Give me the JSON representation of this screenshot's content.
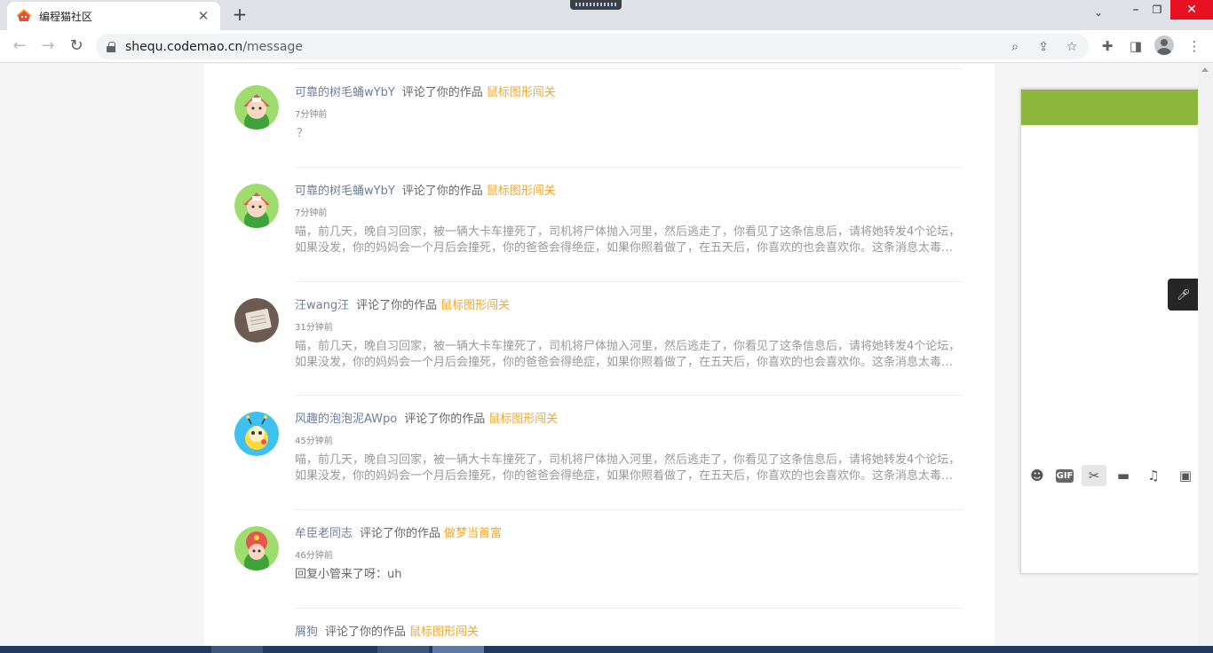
{
  "browser": {
    "tab_title": "编程猫社区",
    "url_host": "shequ.codemao.cn",
    "url_path": "/message",
    "icons": [
      "close-icon",
      "plus-icon",
      "back-icon",
      "forward-icon",
      "reload-icon",
      "lock-icon",
      "zoom-icon",
      "share-icon",
      "star-icon",
      "puzzle-icon",
      "sidepanel-icon",
      "profile-icon",
      "menu-icon",
      "minimize-icon",
      "maximize-icon"
    ]
  },
  "messages": [
    {
      "user": "可靠的树毛蛹wYbY",
      "action": "评论了你的作品",
      "work": "鼠标图形闯关",
      "time": "7分钟前",
      "content": "？"
    },
    {
      "user": "可靠的树毛蛹wYbY",
      "action": "评论了你的作品",
      "work": "鼠标图形闯关",
      "time": "7分钟前",
      "content": "喵，前几天，晚自习回家，被一辆大卡车撞死了，司机将尸体抛入河里，然后逃走了，你看见了这条信息后，请将她转发4个论坛，如果没发，你的妈妈会一个月后会撞死，你的爸爸会得绝症，如果你照着做了，在五天后，你喜欢的也会喜欢你。这条消息太毒了，我不..."
    },
    {
      "user": "汪wang汪",
      "action": "评论了你的作品",
      "work": "鼠标图形闯关",
      "time": "31分钟前",
      "content": "喵，前几天，晚自习回家，被一辆大卡车撞死了，司机将尸体抛入河里，然后逃走了，你看见了这条信息后，请将她转发4个论坛，如果没发，你的妈妈会一个月后会撞死，你的爸爸会得绝症，如果你照着做了，在五天后，你喜欢的也会喜欢你。这条消息太毒了，我不..."
    },
    {
      "user": "风趣的泡泡泥AWpo",
      "action": "评论了你的作品",
      "work": "鼠标图形闯关",
      "time": "45分钟前",
      "content": "喵，前几天，晚自习回家，被一辆大卡车撞死了，司机将尸体抛入河里，然后逃走了，你看见了这条信息后，请将她转发4个论坛，如果没发，你的妈妈会一个月后会撞死，你的爸爸会得绝症，如果你照着做了，在五天后，你喜欢的也会喜欢你。这条消息太毒了，我不..."
    },
    {
      "user": "牟臣老同志",
      "action": "评论了你的作品",
      "work": "做梦当首富",
      "time": "46分钟前",
      "content": "回复小管来了呀：uh"
    },
    {
      "user": "屑狗",
      "action": "评论了你的作品",
      "work": "鼠标图形闯关",
      "time": "",
      "content": ""
    }
  ],
  "side_panel": {
    "toolbar_icons": [
      "emoji-icon",
      "gif-icon",
      "scissors-icon",
      "folder-icon",
      "music-icon",
      "image-icon",
      "more-icon"
    ],
    "gif_label": "GIF",
    "accent": "#8cb63c"
  },
  "colors": {
    "username": "#6b7f99",
    "work_link": "#f5a623",
    "body_text": "#999999"
  }
}
